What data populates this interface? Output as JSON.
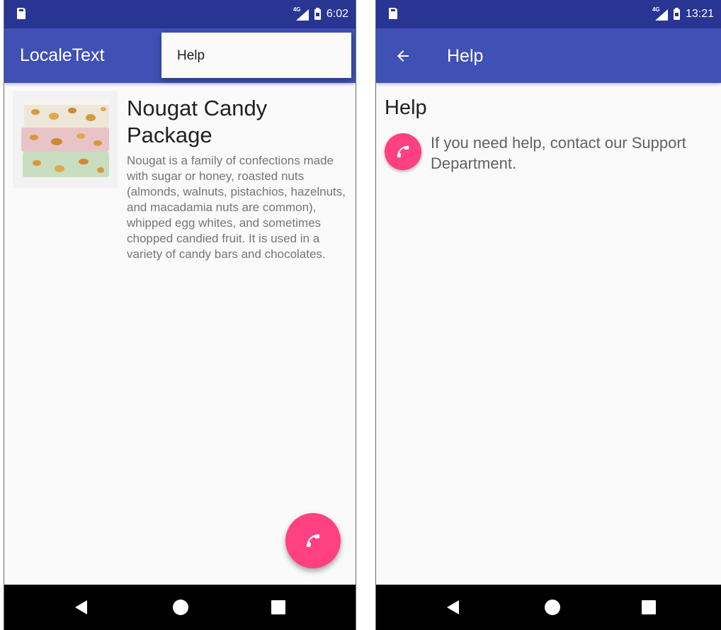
{
  "colors": {
    "status_bar": "#283593",
    "app_bar": "#3f51b5",
    "fab": "#ff4081",
    "background": "#fafafa",
    "nav_bar": "#000000"
  },
  "screen1": {
    "status_bar": {
      "network": "4G",
      "time": "6:02"
    },
    "app_bar": {
      "title": "LocaleText"
    },
    "overflow_menu": {
      "items": [
        {
          "label": "Help"
        }
      ]
    },
    "product": {
      "image_icon": "nougat-candy-image",
      "title": "Nougat Candy Package",
      "description": "Nougat is a family of confections made with sugar or honey, roasted nuts (almonds, walnuts, pistachios, hazelnuts, and macadamia nuts are common), whipped egg whites, and sometimes chopped candied fruit. It is used in a variety of candy bars and chocolates."
    },
    "fab_icon": "phone-icon",
    "nav_bar": {
      "icons": [
        "back-icon",
        "home-icon",
        "recents-icon"
      ]
    }
  },
  "screen2": {
    "status_bar": {
      "network": "4G",
      "time": "13:21"
    },
    "app_bar": {
      "back_icon": "arrow-back-icon",
      "title": "Help"
    },
    "heading": "Help",
    "fab_icon": "phone-icon",
    "help_text": "If you need help, contact our Support Department.",
    "nav_bar": {
      "icons": [
        "back-icon",
        "home-icon",
        "recents-icon"
      ]
    }
  }
}
